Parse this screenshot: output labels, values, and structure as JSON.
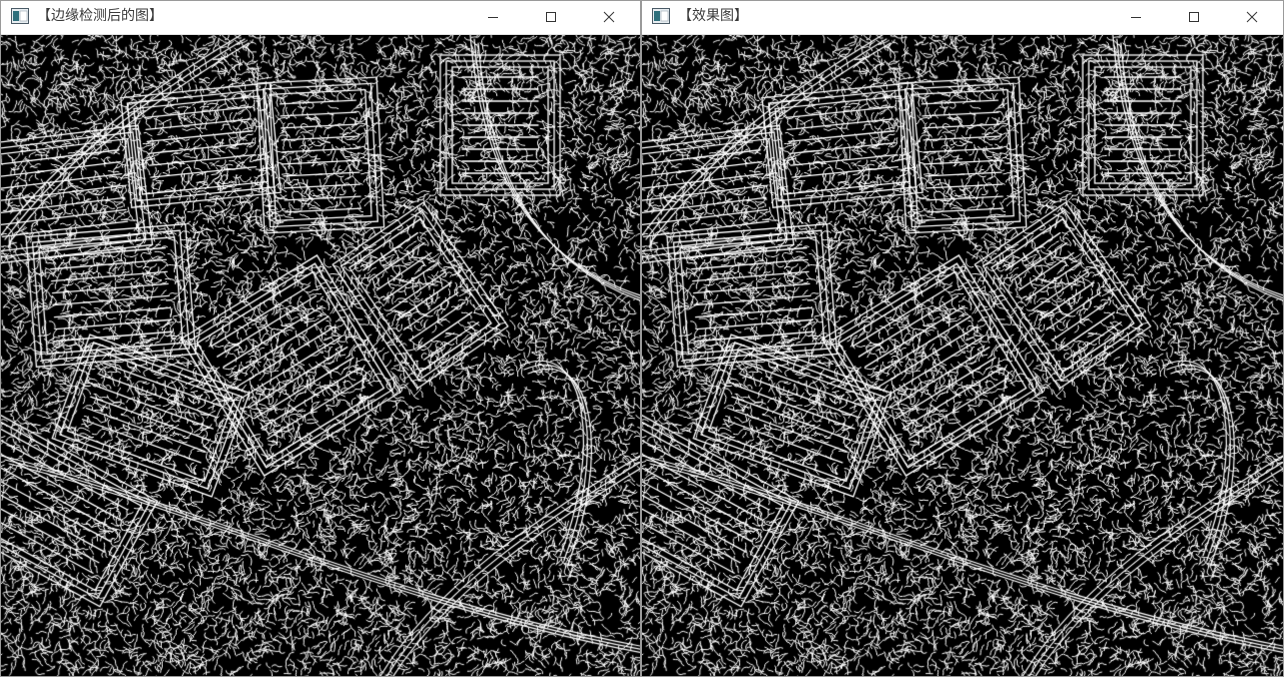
{
  "windows": [
    {
      "title": "【边缘检测后的图】",
      "image_description_icon": "edge-map-image"
    },
    {
      "title": "【效果图】",
      "image_description_icon": "edge-map-image"
    }
  ],
  "icons": {
    "app": "opencv-window-icon",
    "minimize": "minimize-icon",
    "maximize": "maximize-icon",
    "close": "close-icon"
  },
  "colors": {
    "titlebar_bg": "#ffffff",
    "title_text": "#3a3a3a",
    "image_bg": "#000000",
    "edge": "#ffffff"
  }
}
